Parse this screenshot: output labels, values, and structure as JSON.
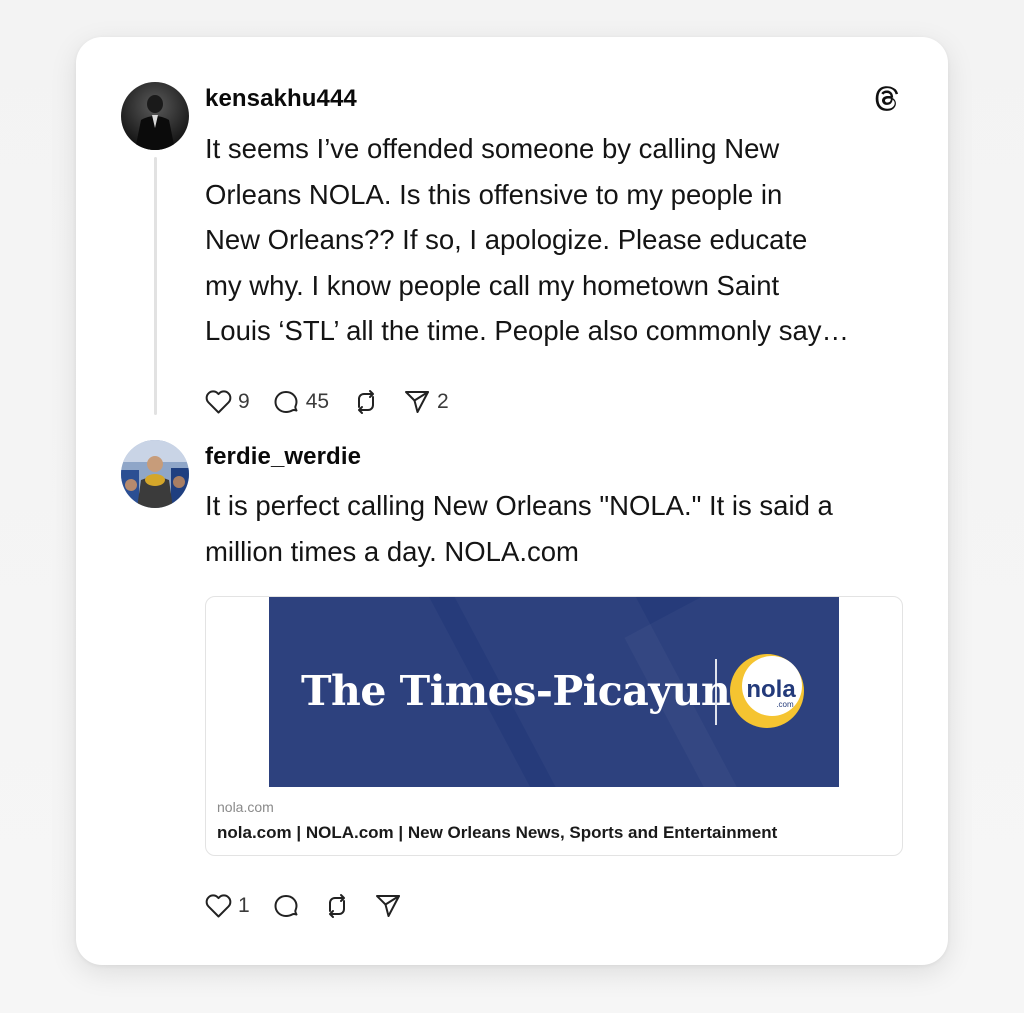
{
  "post1": {
    "username": "kensakhu444",
    "text_lines": [
      "It seems I’ve offended someone by calling New",
      "Orleans NOLA. Is this offensive to my people in",
      "New Orleans?? If so, I apologize. Please educate",
      "my why. I know people call my hometown Saint",
      "Louis ‘STL’ all the time. People also commonly say…"
    ],
    "likes": "9",
    "replies": "45",
    "shares": "2"
  },
  "post2": {
    "username": "ferdie_werdie",
    "text_lines": [
      "It is perfect calling New Orleans \"NOLA.\" It is said a",
      "million times a day. NOLA.com"
    ],
    "likes": "1"
  },
  "link_card": {
    "banner_title": "The Times-Picayune",
    "badge_text": "nola",
    "badge_subtext": ".com",
    "domain": "nola.com",
    "title": "nola.com | NOLA.com | New Orleans News, Sports and Entertainment",
    "banner_color": "#263b7a",
    "badge_color": "#f5c431"
  },
  "icons": {
    "app_logo": "threads-icon",
    "like": "heart-icon",
    "reply": "comment-icon",
    "repost": "repost-icon",
    "share": "send-icon"
  }
}
